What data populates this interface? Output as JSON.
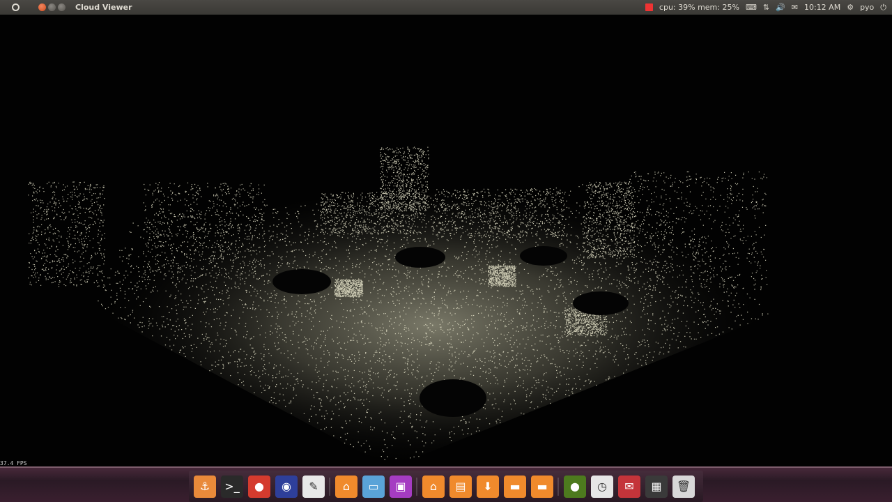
{
  "window": {
    "title": "Cloud Viewer"
  },
  "indicators": {
    "system_monitor": "cpu: 39% mem: 25%",
    "time": "10:12 AM",
    "user": "pyo"
  },
  "viewer": {
    "fps": "37.4 FPS"
  },
  "dock": {
    "items": [
      {
        "name": "anchor-icon",
        "glyph": "⚓",
        "bg": "#e98a3a"
      },
      {
        "name": "terminal-icon",
        "glyph": ">_",
        "bg": "#2a2a2a"
      },
      {
        "name": "chrome-icon",
        "glyph": "●",
        "bg": "#d43b2e"
      },
      {
        "name": "eclipse-icon",
        "glyph": "◉",
        "bg": "#2e3f9a"
      },
      {
        "name": "text-editor-icon",
        "glyph": "✎",
        "bg": "#e8e8e8"
      },
      {
        "name": "home-folder-icon",
        "glyph": "⌂",
        "bg": "#f08a2c"
      },
      {
        "name": "window-icon",
        "glyph": "▭",
        "bg": "#5aa3d8"
      },
      {
        "name": "display-icon",
        "glyph": "▣",
        "bg": "#a53cc2"
      },
      {
        "name": "folder-home-icon",
        "glyph": "⌂",
        "bg": "#f08a2c"
      },
      {
        "name": "folder-documents-icon",
        "glyph": "▤",
        "bg": "#f08a2c"
      },
      {
        "name": "folder-downloads-icon",
        "glyph": "⬇",
        "bg": "#f08a2c"
      },
      {
        "name": "folder-icon",
        "glyph": "▬",
        "bg": "#f08a2c"
      },
      {
        "name": "folder-2-icon",
        "glyph": "▬",
        "bg": "#f08a2c"
      },
      {
        "name": "green-orb-icon",
        "glyph": "●",
        "bg": "#4d7a1e"
      },
      {
        "name": "clock-icon",
        "glyph": "◷",
        "bg": "#e6e6e6"
      },
      {
        "name": "mail-icon",
        "glyph": "✉",
        "bg": "#c4343a"
      },
      {
        "name": "workspace-switcher-icon",
        "glyph": "▦",
        "bg": "#3a3a3a"
      },
      {
        "name": "trash-icon",
        "glyph": "🗑",
        "bg": "#d8d8d8"
      }
    ]
  }
}
